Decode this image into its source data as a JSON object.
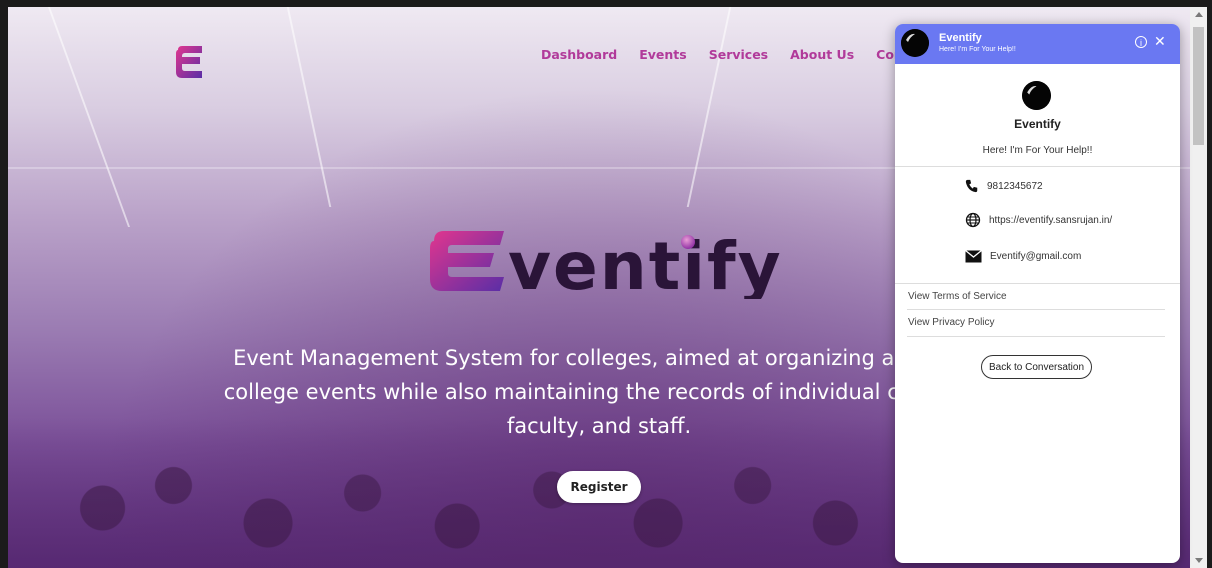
{
  "nav": {
    "items": [
      "Dashboard",
      "Events",
      "Services",
      "About Us",
      "Cont"
    ]
  },
  "hero": {
    "logo_text": "Eventify",
    "description_lines": [
      "Event Management System for colleges, aimed at organizing and coo",
      "college events while also maintaining the records of individual contribu",
      "faculty, and staff."
    ],
    "register_label": "Register"
  },
  "chat": {
    "header_title": "Eventify",
    "header_subtitle": "Here! I'm For Your Help!!",
    "profile_name": "Eventify",
    "profile_tagline": "Here! I'm For Your Help!!",
    "phone": "9812345672",
    "website": "https://eventify.sansrujan.in/",
    "email": "Eventify@gmail.com",
    "terms_label": "View Terms of Service",
    "privacy_label": "View Privacy Policy",
    "back_label": "Back to Conversation",
    "header_color": "#6a78f2"
  },
  "colors": {
    "nav_text": "#b13a9a",
    "logo_pink": "#e2368e",
    "logo_purple": "#5a2ea6"
  },
  "icons": [
    "eventify-logo-icon",
    "info-icon",
    "close-icon",
    "phone-icon",
    "globe-icon",
    "email-icon"
  ]
}
